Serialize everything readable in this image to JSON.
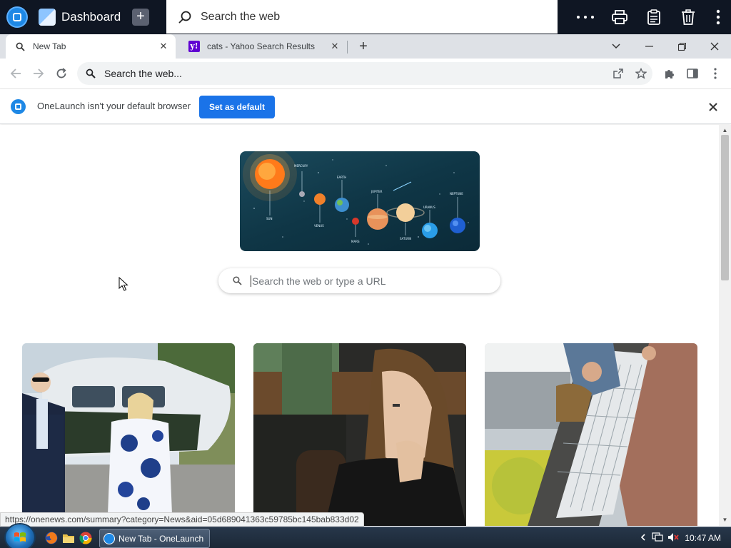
{
  "dock": {
    "dashboard_label": "Dashboard",
    "search_placeholder": "Search the web",
    "icons": [
      "onelaunch-logo-icon",
      "dashboard-icon",
      "plus-icon",
      "search-icon",
      "more-icon",
      "print-icon",
      "clipboard-icon",
      "trash-icon",
      "kebab-icon"
    ]
  },
  "tabs": [
    {
      "title": "New Tab",
      "icon": "search-icon",
      "active": true
    },
    {
      "title": "cats - Yahoo Search Results",
      "icon": "yahoo-icon",
      "active": false
    }
  ],
  "toolbar": {
    "omnibox_placeholder": "Search the web..."
  },
  "infobar": {
    "message": "OneLaunch isn't your default browser",
    "button_label": "Set as default"
  },
  "hero": {
    "planet_labels": [
      "MERCURY",
      "SUN",
      "VENUS",
      "EARTH",
      "MARS",
      "JUPITER",
      "SATURN",
      "URANUS",
      "NEPTUNE"
    ]
  },
  "page_search": {
    "placeholder": "Search the web or type a URL"
  },
  "status_bar": {
    "url": "https://onenews.com/summary?category=News&aid=05d689041363c59785bc145bab833d02"
  },
  "taskbar": {
    "active_window": "New Tab - OneLaunch",
    "clock": "10:47 AM"
  },
  "colors": {
    "dock_bg": "#0f1623",
    "accent": "#1a73e8",
    "onelaunch_blue": "#1e88e5",
    "yahoo_purple": "#6001d2"
  }
}
